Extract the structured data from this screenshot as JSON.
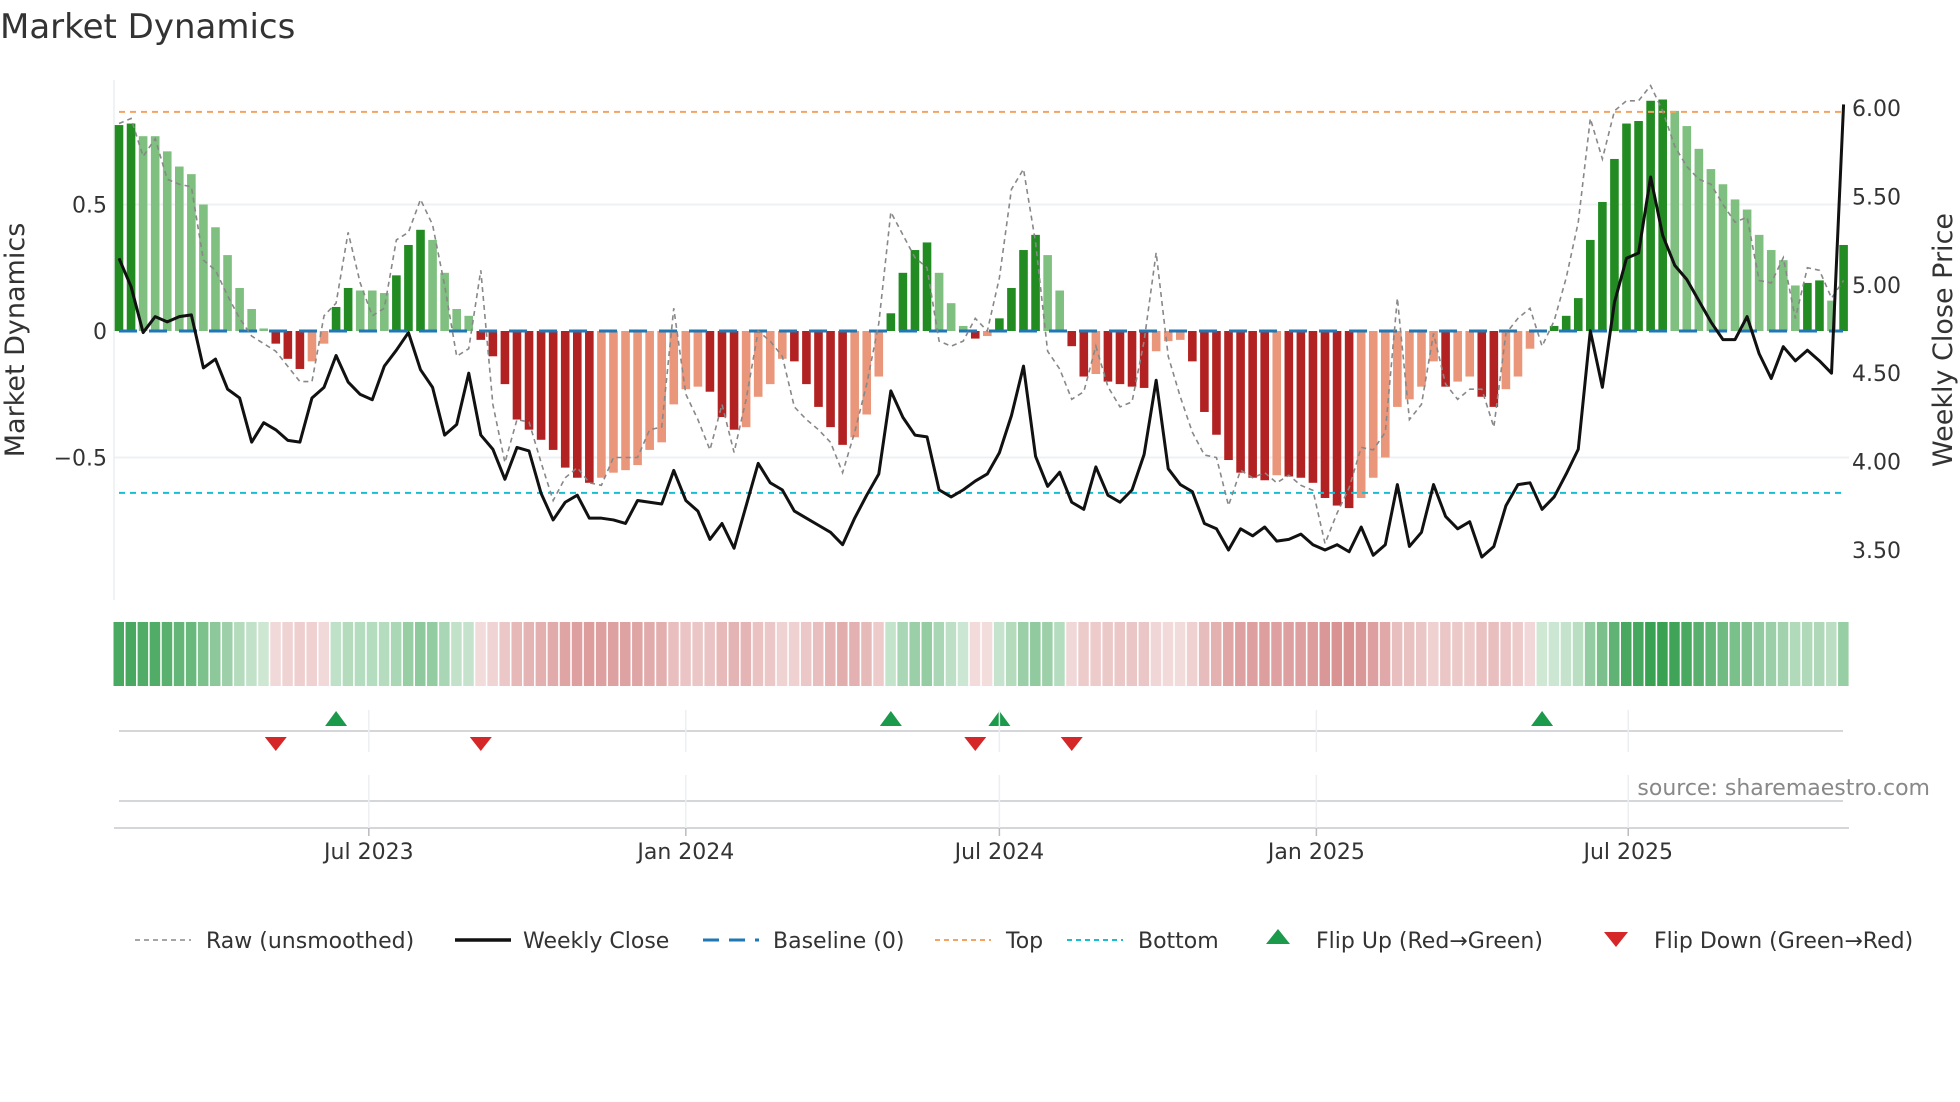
{
  "title": "Market Dynamics",
  "source": "source: sharemaestro.com",
  "colors": {
    "strong_green": "#228b22",
    "weak_green": "#7fbf7f",
    "strong_red": "#b22222",
    "weak_red": "#e9967a",
    "top": "#f4a460",
    "bottom": "#17becf",
    "baseline": "#1f77b4",
    "raw": "#888888",
    "close": "#111111",
    "flip_up": "#1a9a4a",
    "flip_down": "#d62728"
  },
  "legend": [
    {
      "key": "raw",
      "label": "Raw (unsmoothed)"
    },
    {
      "key": "close",
      "label": "Weekly Close"
    },
    {
      "key": "baseline",
      "label": "Baseline (0)"
    },
    {
      "key": "top",
      "label": "Top"
    },
    {
      "key": "bottom",
      "label": "Bottom"
    },
    {
      "key": "flip_up",
      "label": "Flip Up (Red→Green)"
    },
    {
      "key": "flip_down",
      "label": "Flip Down (Green→Red)"
    }
  ],
  "chart_data": {
    "type": "bar",
    "title": "Market Dynamics",
    "ylabel": "Market Dynamics",
    "ylabel_right": "Weekly Close Price",
    "frequency": "weekly",
    "start_date": "2023-02-06",
    "ylim": [
      -0.88,
      0.98
    ],
    "ylim_right": [
      3.27,
      6.19
    ],
    "yticks": [
      {
        "v": 0.5,
        "label": "0.5"
      },
      {
        "v": 0,
        "label": "0"
      },
      {
        "v": -0.5,
        "label": "−0.5"
      }
    ],
    "yticks_right": [
      {
        "v": 6.0,
        "label": "6.00"
      },
      {
        "v": 5.5,
        "label": "5.50"
      },
      {
        "v": 5.0,
        "label": "5.00"
      },
      {
        "v": 4.5,
        "label": "4.50"
      },
      {
        "v": 4.0,
        "label": "4.00"
      },
      {
        "v": 3.5,
        "label": "3.50"
      }
    ],
    "xticks": [
      {
        "date": "2023-07-01",
        "label": "Jul 2023"
      },
      {
        "date": "2024-01-01",
        "label": "Jan 2024"
      },
      {
        "date": "2024-07-01",
        "label": "Jul 2024"
      },
      {
        "date": "2025-01-01",
        "label": "Jan 2025"
      },
      {
        "date": "2025-07-01",
        "label": "Jul 2025"
      }
    ],
    "top": 0.866,
    "bottom": -0.64,
    "baseline": 0,
    "momentum": [
      0.814,
      0.82,
      0.77,
      0.77,
      0.71,
      0.65,
      0.62,
      0.5,
      0.41,
      0.3,
      0.17,
      0.087,
      0.01,
      -0.05,
      -0.11,
      -0.15,
      -0.12,
      -0.05,
      0.095,
      0.17,
      0.16,
      0.16,
      0.15,
      0.22,
      0.34,
      0.4,
      0.36,
      0.23,
      0.087,
      0.06,
      -0.035,
      -0.1,
      -0.21,
      -0.35,
      -0.39,
      -0.43,
      -0.47,
      -0.54,
      -0.58,
      -0.6,
      -0.58,
      -0.56,
      -0.55,
      -0.53,
      -0.47,
      -0.44,
      -0.29,
      -0.23,
      -0.22,
      -0.24,
      -0.34,
      -0.39,
      -0.38,
      -0.26,
      -0.21,
      -0.11,
      -0.12,
      -0.21,
      -0.3,
      -0.38,
      -0.45,
      -0.42,
      -0.33,
      -0.18,
      0.07,
      0.23,
      0.32,
      0.35,
      0.23,
      0.11,
      0.02,
      -0.03,
      -0.02,
      0.05,
      0.17,
      0.32,
      0.38,
      0.3,
      0.16,
      -0.06,
      -0.18,
      -0.17,
      -0.2,
      -0.21,
      -0.22,
      -0.225,
      -0.08,
      -0.04,
      -0.035,
      -0.12,
      -0.32,
      -0.41,
      -0.51,
      -0.56,
      -0.58,
      -0.59,
      -0.57,
      -0.575,
      -0.58,
      -0.6,
      -0.66,
      -0.69,
      -0.7,
      -0.66,
      -0.58,
      -0.5,
      -0.3,
      -0.27,
      -0.22,
      -0.12,
      -0.22,
      -0.2,
      -0.18,
      -0.26,
      -0.3,
      -0.23,
      -0.18,
      -0.07,
      0.005,
      0.02,
      0.06,
      0.13,
      0.36,
      0.51,
      0.68,
      0.82,
      0.83,
      0.91,
      0.915,
      0.87,
      0.81,
      0.72,
      0.64,
      0.58,
      0.52,
      0.48,
      0.38,
      0.32,
      0.28,
      0.18,
      0.19,
      0.2,
      0.12,
      0.34
    ],
    "raw": [
      0.82,
      0.84,
      0.69,
      0.76,
      0.6,
      0.58,
      0.57,
      0.28,
      0.24,
      0.14,
      0.05,
      -0.02,
      -0.05,
      -0.08,
      -0.14,
      -0.2,
      -0.2,
      0.06,
      0.11,
      0.39,
      0.19,
      0.06,
      0.09,
      0.36,
      0.39,
      0.52,
      0.42,
      0.18,
      -0.1,
      -0.07,
      0.24,
      -0.29,
      -0.52,
      -0.35,
      -0.36,
      -0.52,
      -0.67,
      -0.58,
      -0.54,
      -0.6,
      -0.61,
      -0.5,
      -0.5,
      -0.5,
      -0.39,
      -0.38,
      0.09,
      -0.25,
      -0.35,
      -0.47,
      -0.29,
      -0.48,
      -0.27,
      0.0,
      -0.04,
      -0.1,
      -0.3,
      -0.35,
      -0.39,
      -0.44,
      -0.56,
      -0.4,
      -0.21,
      0.03,
      0.47,
      0.38,
      0.29,
      0.25,
      -0.04,
      -0.06,
      -0.04,
      0.05,
      0.0,
      0.21,
      0.56,
      0.64,
      0.35,
      -0.08,
      -0.15,
      -0.27,
      -0.24,
      -0.06,
      -0.22,
      -0.3,
      -0.28,
      -0.04,
      0.31,
      -0.1,
      -0.26,
      -0.4,
      -0.49,
      -0.5,
      -0.69,
      -0.55,
      -0.58,
      -0.56,
      -0.6,
      -0.57,
      -0.61,
      -0.63,
      -0.84,
      -0.72,
      -0.62,
      -0.46,
      -0.47,
      -0.4,
      0.13,
      -0.35,
      -0.29,
      -0.01,
      -0.21,
      -0.27,
      -0.23,
      -0.23,
      -0.38,
      -0.01,
      0.05,
      0.09,
      -0.06,
      0.04,
      0.21,
      0.43,
      0.84,
      0.68,
      0.87,
      0.91,
      0.91,
      0.97,
      0.87,
      0.73,
      0.65,
      0.6,
      0.58,
      0.5,
      0.43,
      0.45,
      0.2,
      0.19,
      0.29,
      0.05,
      0.25,
      0.24,
      0.13,
      0.2
    ],
    "close": [
      5.15,
      4.99,
      4.73,
      4.82,
      4.79,
      4.82,
      4.83,
      4.53,
      4.58,
      4.41,
      4.36,
      4.11,
      4.22,
      4.18,
      4.12,
      4.11,
      4.36,
      4.42,
      4.6,
      4.45,
      4.38,
      4.35,
      4.54,
      4.63,
      4.73,
      4.52,
      4.42,
      4.15,
      4.21,
      4.5,
      4.15,
      4.07,
      3.9,
      4.08,
      4.06,
      3.82,
      3.67,
      3.77,
      3.81,
      3.68,
      3.68,
      3.67,
      3.65,
      3.78,
      3.77,
      3.76,
      3.95,
      3.78,
      3.72,
      3.56,
      3.65,
      3.51,
      3.75,
      3.99,
      3.88,
      3.84,
      3.72,
      3.68,
      3.64,
      3.6,
      3.53,
      3.68,
      3.81,
      3.93,
      4.4,
      4.25,
      4.15,
      4.14,
      3.84,
      3.8,
      3.84,
      3.89,
      3.93,
      4.05,
      4.26,
      4.54,
      4.03,
      3.86,
      3.94,
      3.77,
      3.73,
      3.97,
      3.81,
      3.77,
      3.84,
      4.04,
      4.46,
      3.96,
      3.87,
      3.83,
      3.65,
      3.62,
      3.5,
      3.62,
      3.58,
      3.63,
      3.55,
      3.56,
      3.59,
      3.53,
      3.5,
      3.53,
      3.49,
      3.63,
      3.47,
      3.53,
      3.87,
      3.52,
      3.6,
      3.87,
      3.69,
      3.62,
      3.66,
      3.46,
      3.52,
      3.75,
      3.87,
      3.88,
      3.73,
      3.8,
      3.93,
      4.07,
      4.74,
      4.42,
      4.9,
      5.15,
      5.18,
      5.61,
      5.28,
      5.11,
      5.03,
      4.91,
      4.79,
      4.69,
      4.69,
      4.82,
      4.61,
      4.47,
      4.65,
      4.57,
      4.63,
      4.57,
      4.5,
      6.02
    ]
  }
}
